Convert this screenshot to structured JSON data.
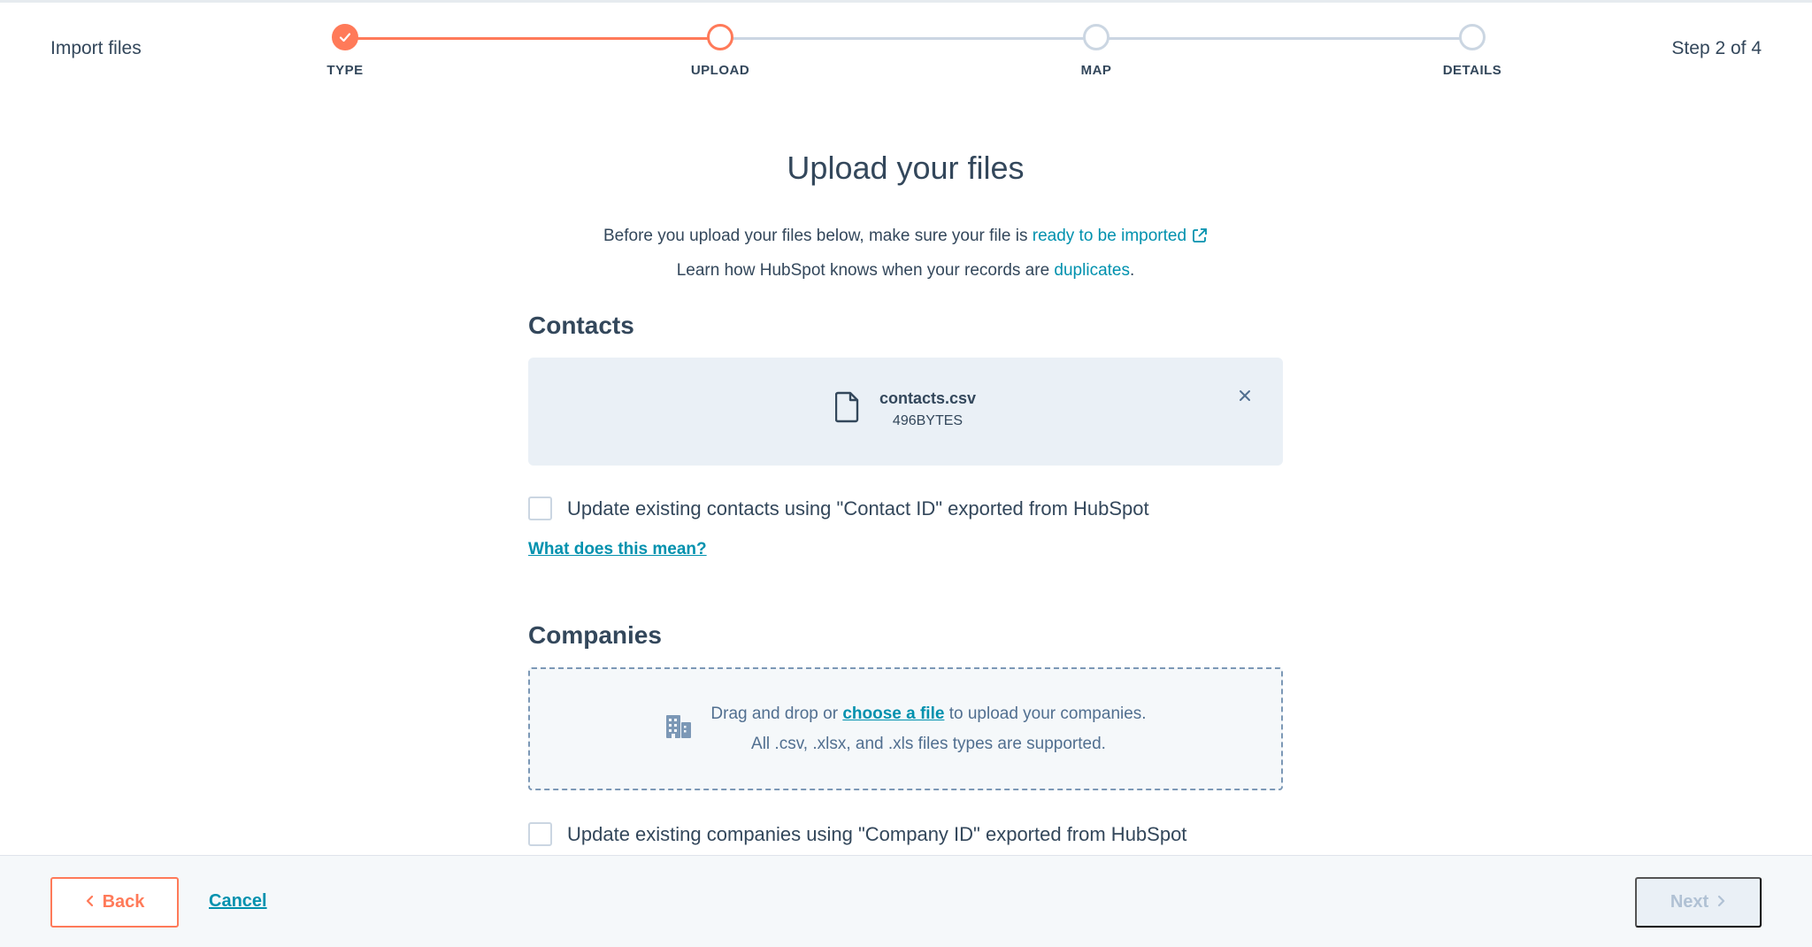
{
  "header": {
    "title": "Import files",
    "step_count": "Step 2 of 4",
    "steps": [
      {
        "label": "TYPE",
        "state": "complete"
      },
      {
        "label": "UPLOAD",
        "state": "active"
      },
      {
        "label": "MAP",
        "state": "pending"
      },
      {
        "label": "DETAILS",
        "state": "pending"
      }
    ],
    "progress_fraction": 0.333
  },
  "main": {
    "title": "Upload your files",
    "intro_line1_prefix": "Before you upload your files below, make sure your file is ",
    "intro_line1_link": "ready to be imported",
    "intro_line2_prefix": "Learn how HubSpot knows when your records are ",
    "intro_line2_link": "duplicates",
    "intro_line2_suffix": "."
  },
  "contacts": {
    "title": "Contacts",
    "file_name": "contacts.csv",
    "file_size": "496BYTES",
    "remove_icon": "close-icon",
    "update_label": "Update existing contacts using \"Contact ID\" exported from HubSpot",
    "update_checked": false,
    "help_link": "What does this mean?"
  },
  "companies": {
    "title": "Companies",
    "drop_prefix": "Drag and drop or ",
    "drop_link": "choose a file",
    "drop_suffix": " to upload your companies.",
    "drop_hint": "All .csv, .xlsx, and .xls files types are supported.",
    "update_label": "Update existing companies using \"Company ID\" exported from HubSpot",
    "update_checked": false
  },
  "footer": {
    "back_label": "Back",
    "cancel_label": "Cancel",
    "next_label": "Next"
  },
  "colors": {
    "accent": "#ff7a59",
    "link": "#0091ae",
    "text": "#33475b",
    "muted": "#cbd6e2"
  }
}
